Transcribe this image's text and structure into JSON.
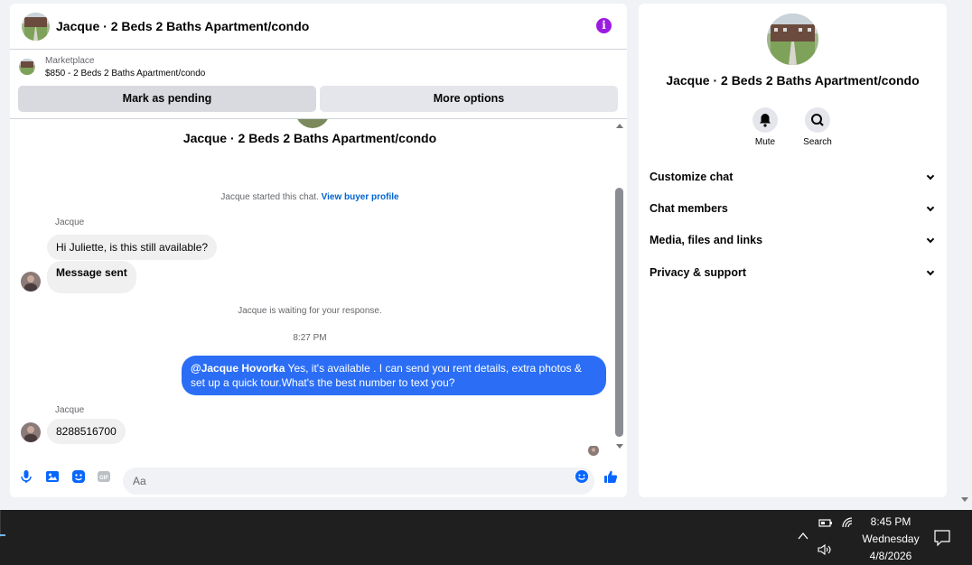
{
  "chat": {
    "title": "Jacque · 2 Beds 2 Baths Apartment/condo",
    "info_icon": "i",
    "listing": {
      "category": "Marketplace",
      "price_line": "$850 - 2 Beds 2 Baths Apartment/condo"
    },
    "buttons": {
      "mark_pending": "Mark as pending",
      "more_options": "More options"
    },
    "conversation_title": "Jacque · 2 Beds 2 Baths Apartment/condo",
    "started_text": "Jacque started this chat.",
    "buyer_profile_link": "View buyer profile",
    "messages": [
      {
        "sender": "Jacque",
        "text": "Hi Juliette, is this still available?"
      },
      {
        "sender": "",
        "text": "Message sent"
      }
    ],
    "waiting_text": "Jacque is waiting for your response.",
    "timestamp": "8:27 PM",
    "outgoing": {
      "mention": "@Jacque Hovorka",
      "text": " Yes, it's available .  I can send you rent details, extra photos & set up a quick tour.What's the best number to text you?"
    },
    "reply": {
      "sender": "Jacque",
      "text": "8288516700"
    },
    "composer_placeholder": "Aa"
  },
  "side": {
    "title": "Jacque · 2 Beds 2 Baths Apartment/condo",
    "actions": {
      "mute": "Mute",
      "search": "Search"
    },
    "sections": [
      "Customize chat",
      "Chat members",
      "Media, files and links",
      "Privacy & support"
    ]
  },
  "taskbar": {
    "time": "8:45 PM",
    "day": "Wednesday",
    "date": "4/8/2026"
  },
  "colors": {
    "accent": "#2b6ef5",
    "link": "#0064d1",
    "info": "#9b1be0"
  },
  "icons": [
    "info-icon",
    "microphone-icon",
    "image-icon",
    "sticker-icon",
    "gif-icon",
    "emoji-icon",
    "thumbs-up-icon",
    "bell-icon",
    "search-icon",
    "chevron-down-icon",
    "battery-icon",
    "wifi-icon",
    "volume-icon",
    "notification-icon"
  ]
}
